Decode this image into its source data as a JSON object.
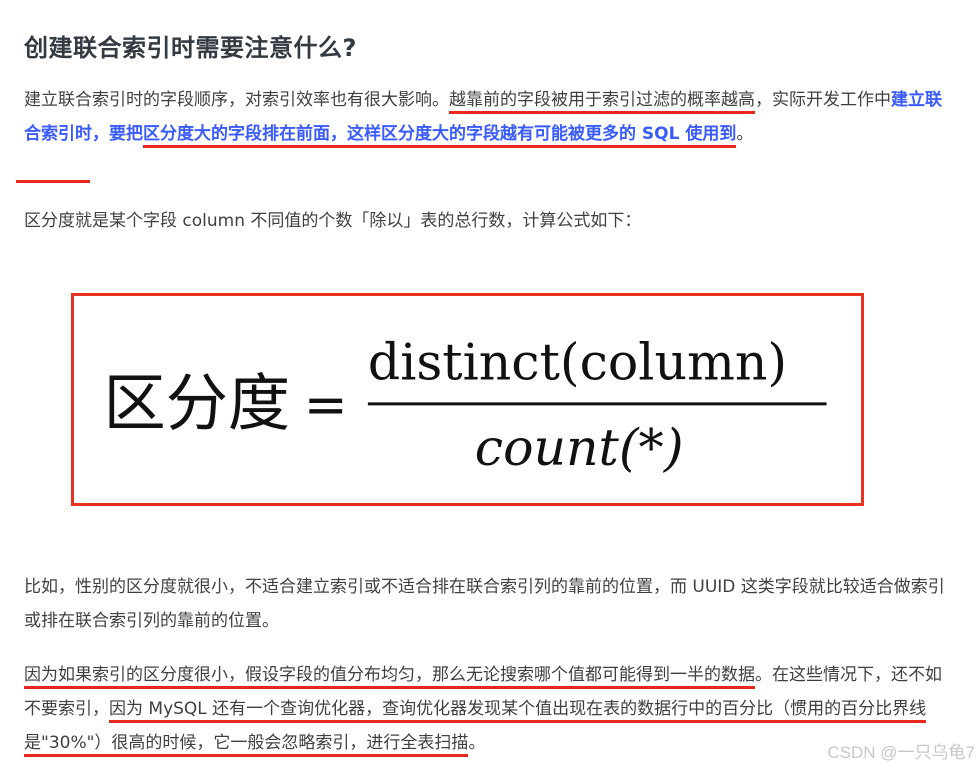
{
  "heading": "创建联合索引时需要注意什么?",
  "para1": {
    "a": "建立联合索引时的字段顺序，对索引效率也有很大影响。",
    "b": "越靠前的字段被用于索引过滤的概率越高",
    "c": "，实际开发工作中",
    "d": "建立联合索引时，要把",
    "e": "区分度大的字段排在前面，这样区分度大的字段越有可能被更多的 SQL 使用到",
    "f": "。"
  },
  "para2": "区分度就是某个字段 column 不同值的个数「除以」表的总行数，计算公式如下：",
  "formula": {
    "lhs": "区分度",
    "equals": "=",
    "numerator": "distinct(column)",
    "denominator": "count(*)"
  },
  "para3": "比如，性别的区分度就很小，不适合建立索引或不适合排在联合索引列的靠前的位置，而 UUID 这类字段就比较适合做索引或排在联合索引列的靠前的位置。",
  "para4": {
    "a": "因为如果索引的区分度很小，假设字段的值分布均匀，那么无论搜索哪个值都可能得到一半的数据",
    "b": "。在这些情况下，还不如不要索引，",
    "c": "因为 MySQL 还有一个查询优化器，查询优化器发现某个值出现在表的数据行中的百分比（惯用的百分比界线是\"30%\"）很高的时候，它一般会忽略索引，进行全表扫描",
    "d": "。"
  },
  "watermark": "CSDN @一只乌龟7",
  "colors": {
    "highlight_blue": "#3a5bff",
    "underline_red": "#e8281f",
    "box_border": "#e8321f"
  }
}
